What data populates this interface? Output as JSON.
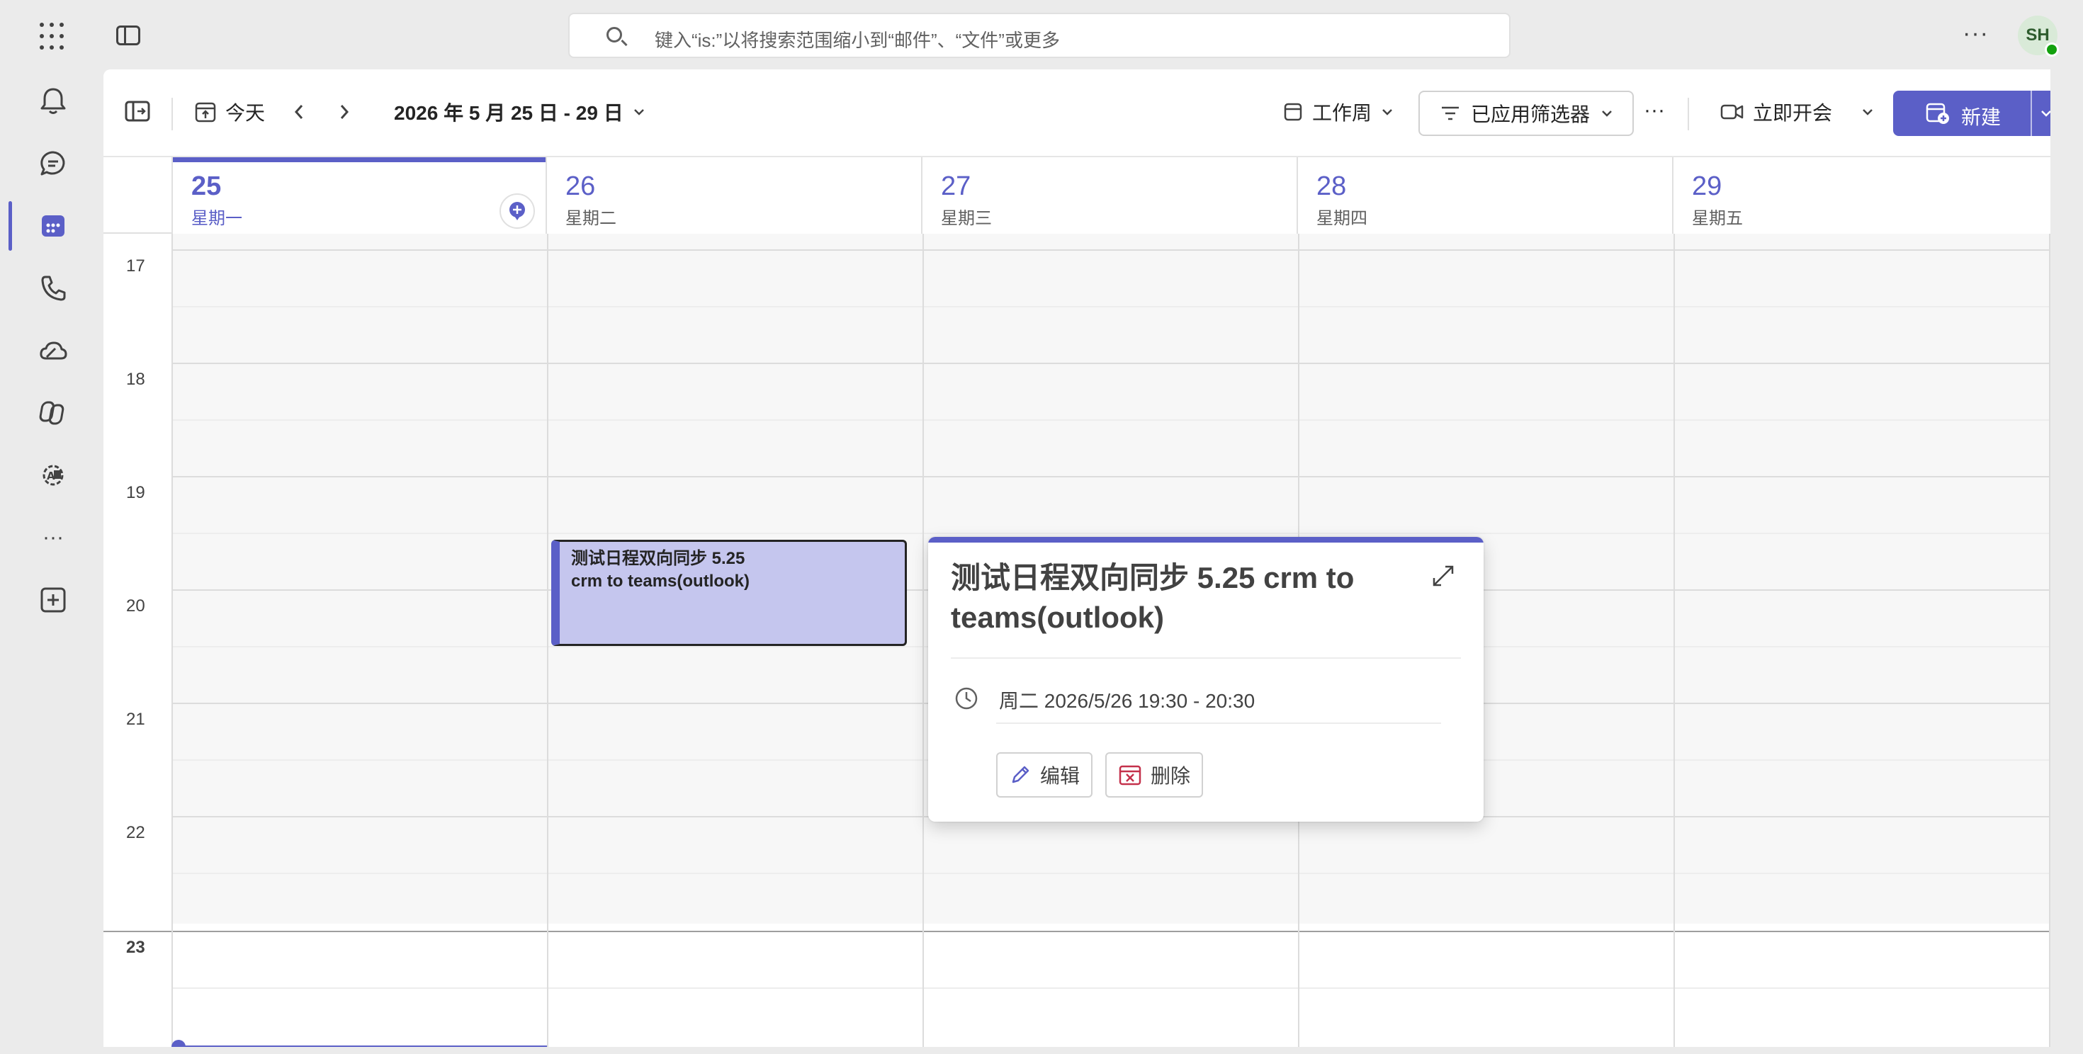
{
  "search": {
    "placeholder": "键入“is:”以将搜索范围缩小到“邮件”、“文件”或更多"
  },
  "user": {
    "initials": "SH"
  },
  "icons": {
    "rail": [
      "bell-icon",
      "chat-icon",
      "calendar-icon",
      "phone-icon",
      "cloud-icon",
      "copilot-icon",
      "apps-gear-icon",
      "more-icon",
      "add-app-icon"
    ]
  },
  "toolbar": {
    "today_label": "今天",
    "date_range": "2026 年 5 月 25 日 - 29 日",
    "view_label": "工作周",
    "filter_label": "已应用筛选器",
    "more_label": "···",
    "meet_label": "立即开会",
    "new_label": "新建"
  },
  "days": [
    {
      "num": "25",
      "name": "星期一"
    },
    {
      "num": "26",
      "name": "星期二"
    },
    {
      "num": "27",
      "name": "星期三"
    },
    {
      "num": "28",
      "name": "星期四"
    },
    {
      "num": "29",
      "name": "星期五"
    }
  ],
  "hours": [
    "17",
    "18",
    "19",
    "20",
    "21",
    "22",
    "23"
  ],
  "event": {
    "title_line1": "测试日程双向同步 5.25",
    "title_line2": "crm to teams(outlook)"
  },
  "popup": {
    "title": "测试日程双向同步 5.25 crm to teams(outlook)",
    "time": "周二 2026/5/26 19:30 - 20:30",
    "edit_label": "编辑",
    "delete_label": "删除"
  },
  "colors": {
    "accent": "#5b5fc7",
    "event_fill": "#c5c6ee",
    "delete_red": "#c4314b"
  }
}
